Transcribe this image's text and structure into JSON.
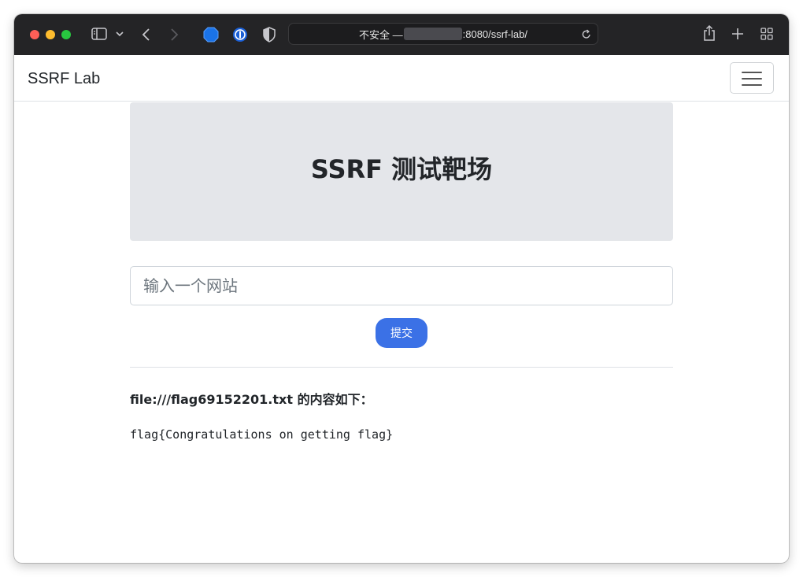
{
  "browser": {
    "address": {
      "prefix": "不安全 —",
      "suffix": ":8080/ssrf-lab/"
    },
    "traffic_lights": {
      "close": "#ff5f57",
      "minimize": "#febc2e",
      "zoom": "#28c840"
    },
    "icons": [
      "sidebar-icon",
      "chevron-down-icon",
      "back-icon",
      "forward-icon",
      "extension-icon",
      "password-manager-icon",
      "privacy-shield-icon",
      "reload-icon",
      "share-icon",
      "new-tab-icon",
      "tab-overview-icon"
    ]
  },
  "navbar": {
    "brand": "SSRF Lab",
    "toggler_icon": "hamburger-menu-icon"
  },
  "hero": {
    "title": "SSRF 测试靶场"
  },
  "form": {
    "url_placeholder": "输入一个网站",
    "url_value": "",
    "submit_label": "提交",
    "submit_color": "#3b71e6"
  },
  "result": {
    "title": "file:///flag69152201.txt 的内容如下：",
    "content": "flag{Congratulations on getting flag}"
  }
}
